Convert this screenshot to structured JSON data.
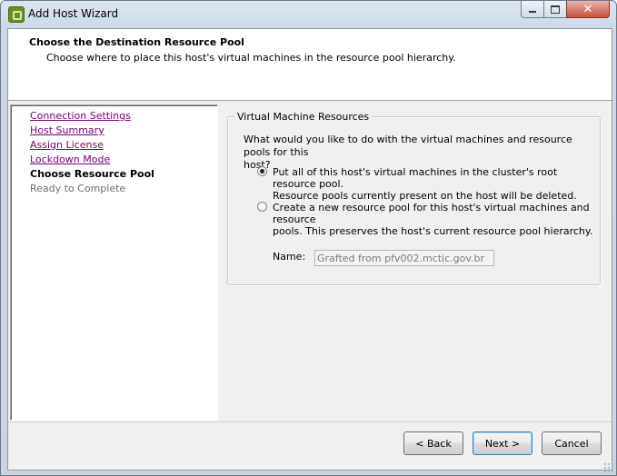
{
  "window": {
    "title": "Add Host Wizard"
  },
  "header": {
    "title": "Choose the Destination Resource Pool",
    "subtitle": "Choose where to place this host's virtual machines in the resource pool hierarchy."
  },
  "steps": [
    {
      "label": "Connection Settings",
      "state": "link"
    },
    {
      "label": "Host Summary",
      "state": "link"
    },
    {
      "label": "Assign License",
      "state": "link"
    },
    {
      "label": "Lockdown Mode",
      "state": "link"
    },
    {
      "label": "Choose Resource Pool",
      "state": "current"
    },
    {
      "label": "Ready to Complete",
      "state": "future"
    }
  ],
  "vm_resources": {
    "legend": "Virtual Machine Resources",
    "question_line1": "What would you like to do with the virtual machines and resource pools for this",
    "question_line2": "host?",
    "option1_line1": "Put all of this host's virtual machines in the cluster's root resource pool.",
    "option1_line2": "Resource pools currently present on the host will be deleted.",
    "option1_selected": true,
    "option2_line1": "Create a new resource pool for this host's virtual machines and resource",
    "option2_line2": "pools.  This preserves the host's current resource pool hierarchy.",
    "option2_selected": false,
    "name_label": "Name:",
    "name_value": "Grafted from pfv002.mctic.gov.br"
  },
  "buttons": {
    "back": "< Back",
    "next": "Next >",
    "cancel": "Cancel"
  },
  "colors": {
    "link": "#800080",
    "disabled_text": "#6d6d6d"
  }
}
